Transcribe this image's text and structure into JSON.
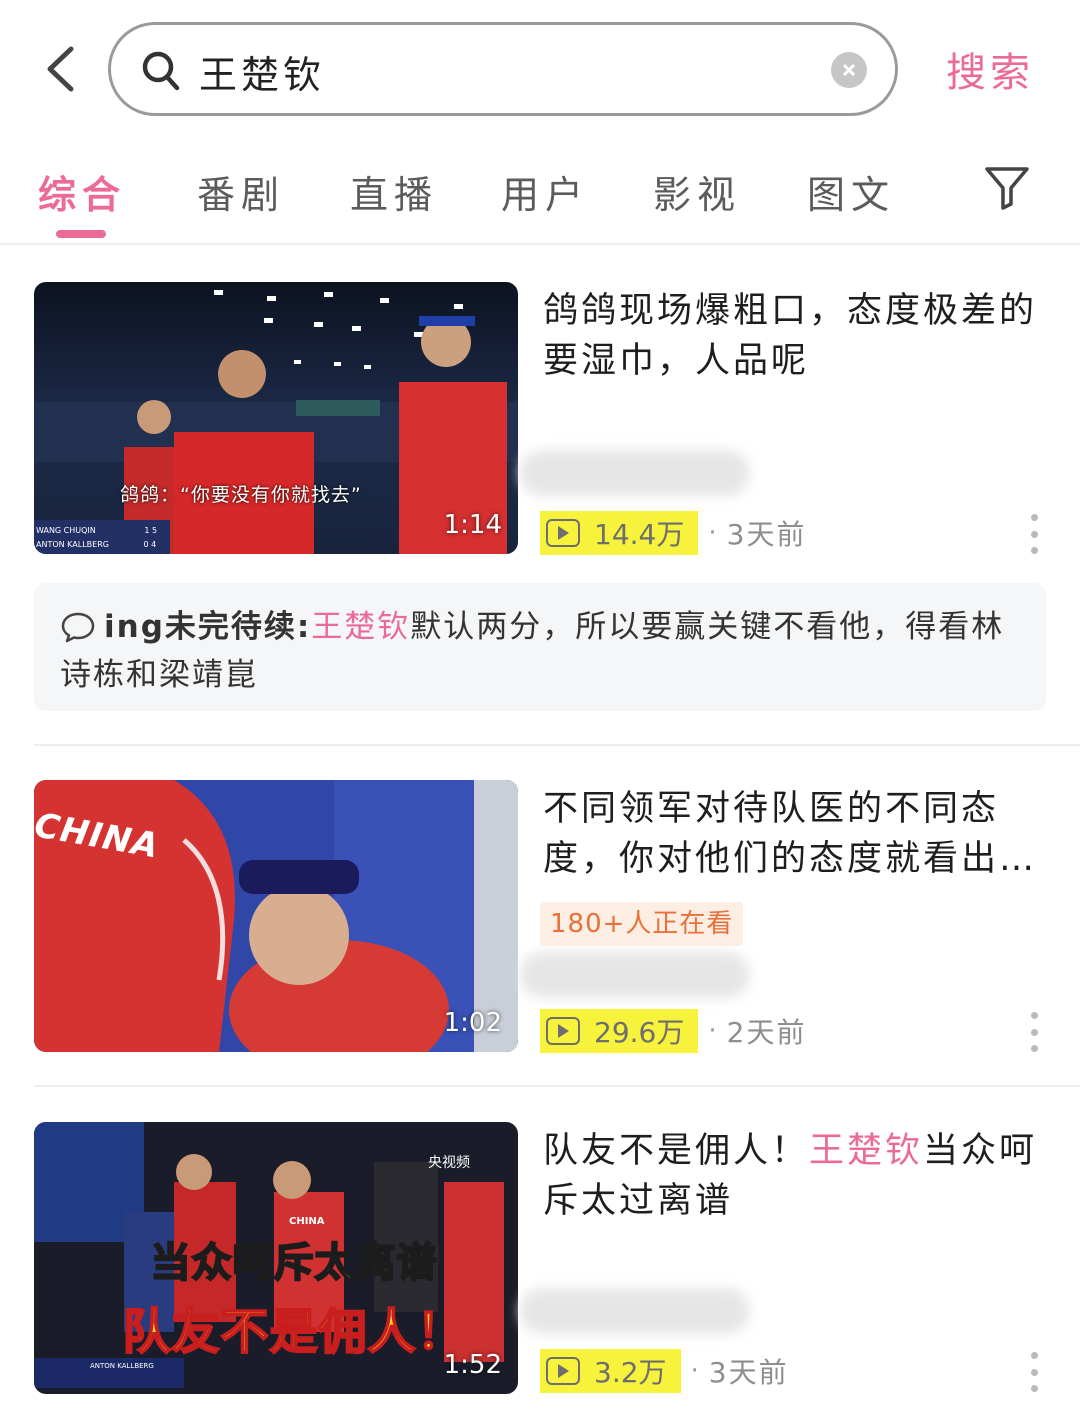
{
  "search": {
    "query": "王楚钦",
    "search_button": "搜索"
  },
  "tabs": [
    {
      "label": "综合",
      "active": true
    },
    {
      "label": "番剧",
      "active": false
    },
    {
      "label": "直播",
      "active": false
    },
    {
      "label": "用户",
      "active": false
    },
    {
      "label": "影视",
      "active": false
    },
    {
      "label": "图文",
      "active": false
    }
  ],
  "colors": {
    "accent": "#eb6a98",
    "highlight": "#f7f23b",
    "live_badge_text": "#e8703a"
  },
  "results": [
    {
      "title": "鸽鸽现场爆粗口，态度极差的要湿巾，人品呢",
      "duration": "1:14",
      "views": "14.4万",
      "time": "3天前",
      "thumbnail": {
        "subtitle": "鸽鸽：“你要没有你就找去”",
        "score_name_1": "WANG CHUQIN",
        "score_name_2": "ANTON KALLBERG",
        "score_1": "1  5",
        "score_2": "0  4"
      }
    },
    {
      "title": "不同领军对待队医的不同态度，你对他们的态度就看出…",
      "duration": "1:02",
      "live_badge": "180+人正在看",
      "views": "29.6万",
      "time": "2天前",
      "thumbnail": {
        "jersey_text": "CHINA"
      }
    },
    {
      "title_before": "队友不是佣人！",
      "title_highlight": "王楚钦",
      "title_after": "当众呵斥太过离谱",
      "duration": "1:52",
      "views": "3.2万",
      "time": "3天前",
      "thumbnail": {
        "line1": "当众呵斥太离谱",
        "line2": "队友不是佣人！",
        "channel": "央视频",
        "jersey_text": "CHINA",
        "score_name": "ANTON KALLBERG"
      }
    }
  ],
  "comment": {
    "author": "ing未完待续:",
    "highlight": "王楚钦",
    "text": "默认两分，所以要赢关键不看他，得看林诗栋和梁靖崑"
  }
}
